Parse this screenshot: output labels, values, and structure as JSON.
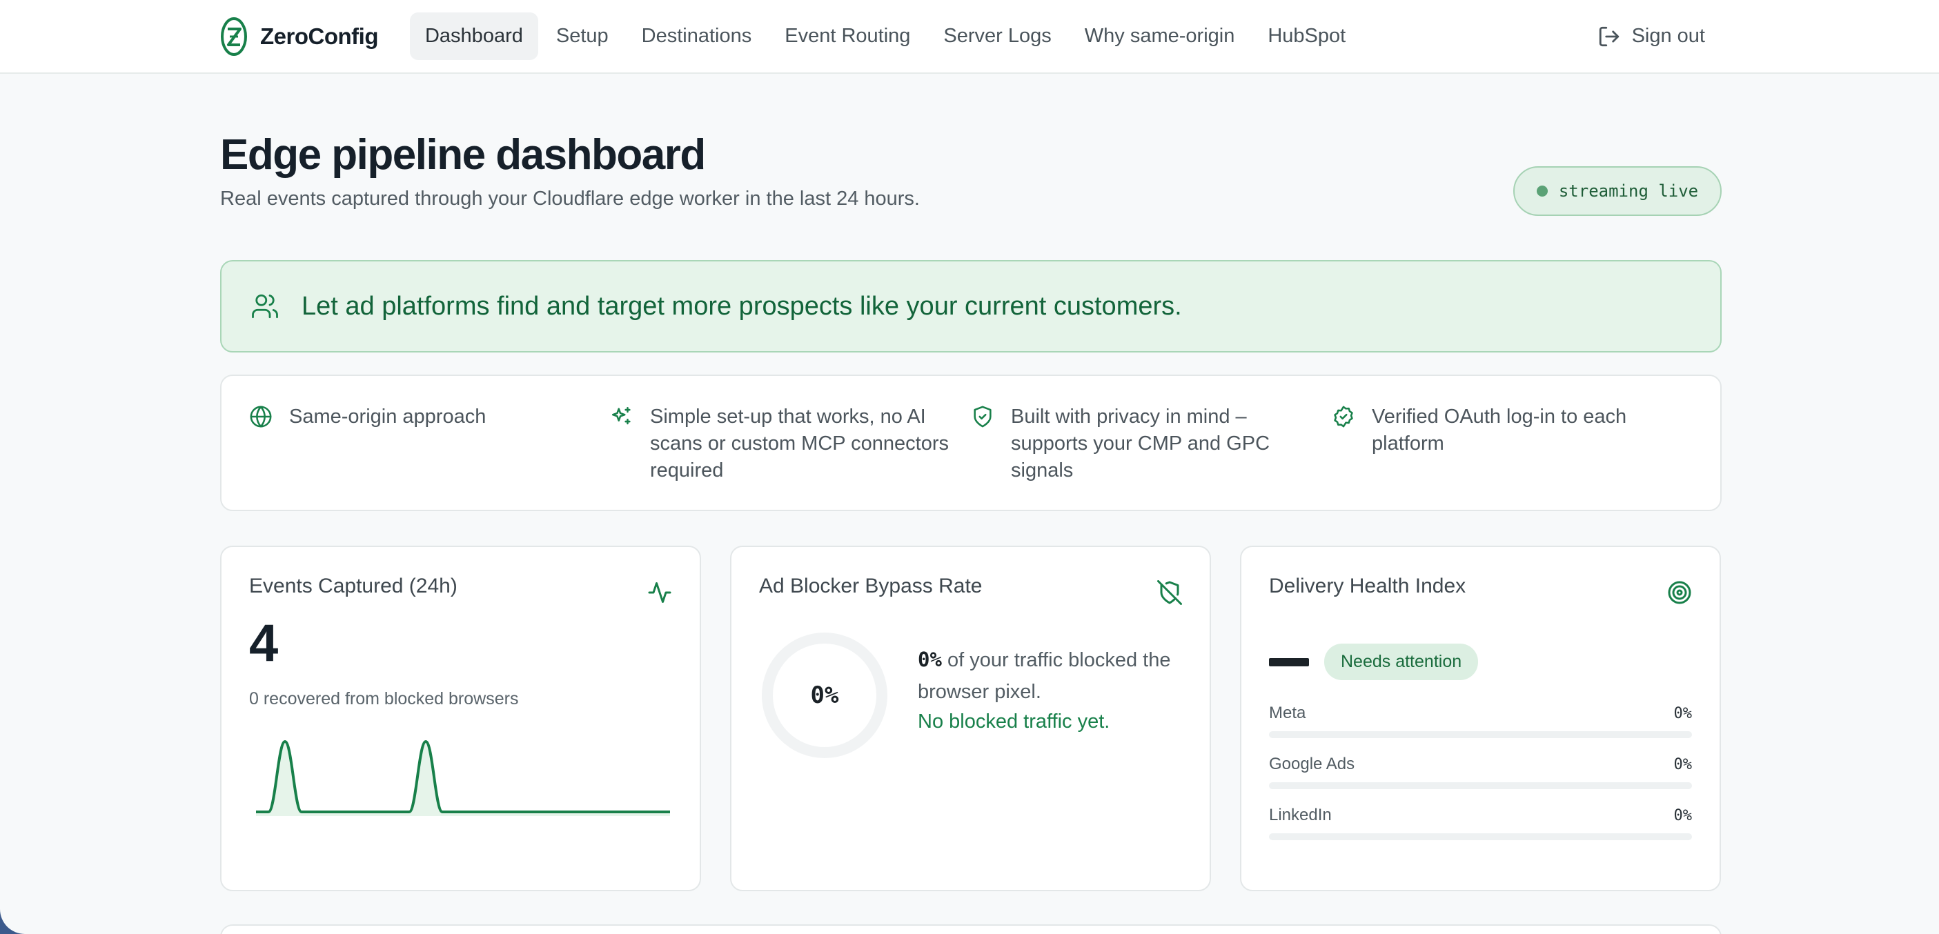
{
  "nav": {
    "brand": "ZeroConfig",
    "links": [
      {
        "label": "Dashboard",
        "active": true
      },
      {
        "label": "Setup"
      },
      {
        "label": "Destinations"
      },
      {
        "label": "Event Routing"
      },
      {
        "label": "Server Logs"
      },
      {
        "label": "Why same-origin"
      },
      {
        "label": "HubSpot"
      }
    ],
    "sign_out": "Sign out"
  },
  "header": {
    "title": "Edge pipeline dashboard",
    "subtitle": "Real events captured through your Cloudflare edge worker in the last 24 hours.",
    "status": "streaming live"
  },
  "banner": {
    "text": "Let ad platforms find and target more prospects like your current customers.",
    "icon": "users-icon"
  },
  "features": [
    {
      "icon": "globe-icon",
      "text": "Same-origin approach"
    },
    {
      "icon": "sparkles-icon",
      "text": "Simple set-up that works, no AI scans or custom MCP connectors required"
    },
    {
      "icon": "shield-check-icon",
      "text": "Built with privacy in mind – supports your CMP and GPC signals"
    },
    {
      "icon": "badge-check-icon",
      "text": "Verified OAuth log-in to each platform"
    }
  ],
  "events_card": {
    "title": "Events Captured (24h)",
    "icon": "activity-icon",
    "value": "4",
    "sub": "0 recovered from blocked browsers"
  },
  "bypass_card": {
    "title": "Ad Blocker Bypass Rate",
    "icon": "shield-off-icon",
    "rate_label": "0%",
    "rate": 0,
    "desc_pct": "0%",
    "desc_rest": " of your traffic blocked the browser pixel.",
    "note": "No blocked traffic yet."
  },
  "health_card": {
    "title": "Delivery Health Index",
    "icon": "target-icon",
    "status": "Needs attention",
    "platforms": [
      {
        "name": "Meta",
        "value": "0%",
        "fraction": 0
      },
      {
        "name": "Google Ads",
        "value": "0%",
        "fraction": 0
      },
      {
        "name": "LinkedIn",
        "value": "0%",
        "fraction": 0
      }
    ]
  },
  "colors": {
    "accent": "#18804a",
    "banner_bg": "#e6f4ea",
    "badge_bg": "#dcefe2"
  }
}
